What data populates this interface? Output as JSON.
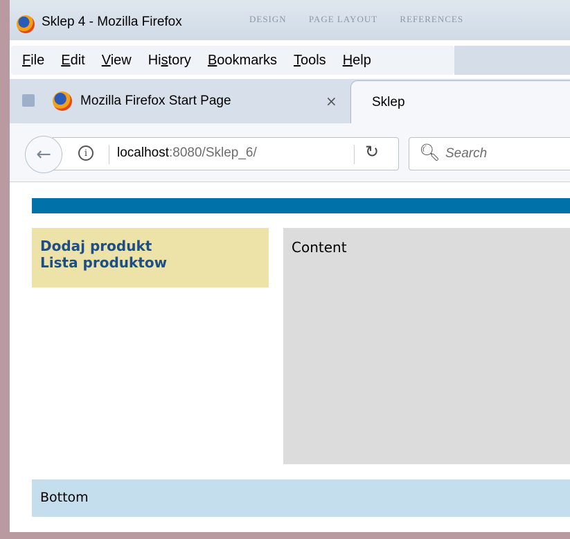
{
  "window": {
    "title": "Sklep 4 - Mozilla Firefox",
    "background_text": [
      "DESIGN",
      "PAGE LAYOUT",
      "REFERENCES"
    ]
  },
  "menubar": {
    "items": [
      {
        "accel": "F",
        "rest": "ile"
      },
      {
        "accel": "E",
        "rest": "dit"
      },
      {
        "accel": "V",
        "rest": "iew"
      },
      {
        "pre": "Hi",
        "accel": "s",
        "rest": "tory"
      },
      {
        "accel": "B",
        "rest": "ookmarks"
      },
      {
        "accel": "T",
        "rest": "ools"
      },
      {
        "accel": "H",
        "rest": "elp"
      }
    ]
  },
  "tabs": [
    {
      "label": "Mozilla Firefox Start Page",
      "close": "×",
      "active": false
    },
    {
      "label": "Sklep",
      "active": true
    }
  ],
  "navbar": {
    "url_host": "localhost",
    "url_path": ":8080/Sklep_6/",
    "search_placeholder": "Search"
  },
  "page": {
    "nav_links": [
      "Dodaj produkt",
      "Lista produktow"
    ],
    "content": "Content",
    "bottom": "Bottom",
    "colors": {
      "top_bar": "#0071a9",
      "sidebar": "#ede3a8",
      "content": "#dcdcdc",
      "bottom": "#c4deed",
      "link": "#1d4f86"
    }
  }
}
